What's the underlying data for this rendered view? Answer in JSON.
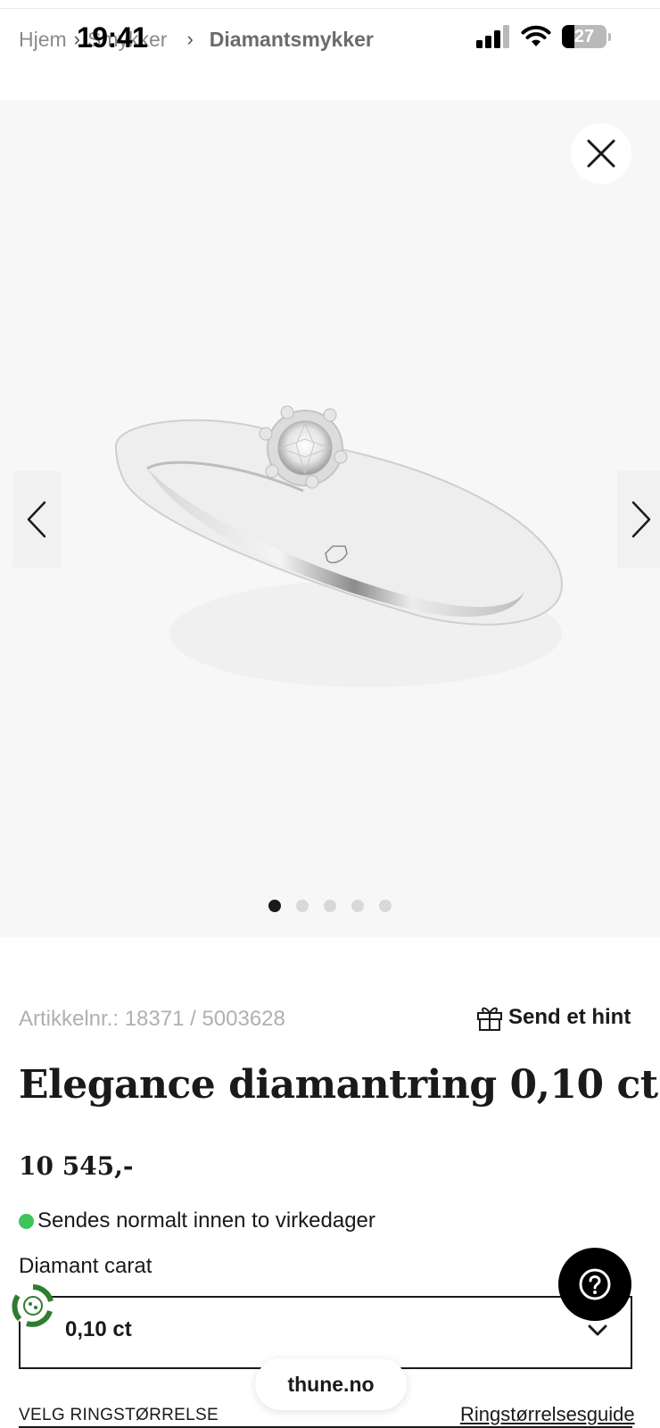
{
  "status_bar": {
    "time": "19:41",
    "battery_level": "27",
    "battery_fraction": 0.27
  },
  "breadcrumb": {
    "items": [
      "Hjem",
      "Smykker",
      "Diamantsmykker"
    ],
    "separator": "›"
  },
  "gallery": {
    "image_count": 5,
    "active_index": 0,
    "background": "#f7f7f7"
  },
  "product": {
    "sku_label": "Artikkelnr.: 18371 / 5003628",
    "hint_label": "Send et hint",
    "title": "Elegance diamantring 0,10 ct",
    "price": "10 545,-",
    "stock_text": "Sendes normalt innen to virkedager",
    "stock_color": "#3cc65a",
    "carat_label": "Diamant carat",
    "carat_value": "0,10 ct",
    "size_label": "VELG RINGSTØRRELSE",
    "size_guide_label": "Ringstørrelsesguide"
  },
  "browser": {
    "url": "thune.no"
  },
  "colors": {
    "text": "#1a1a1a",
    "muted": "#b0b0b0",
    "eco_green": "#2e7d32"
  }
}
